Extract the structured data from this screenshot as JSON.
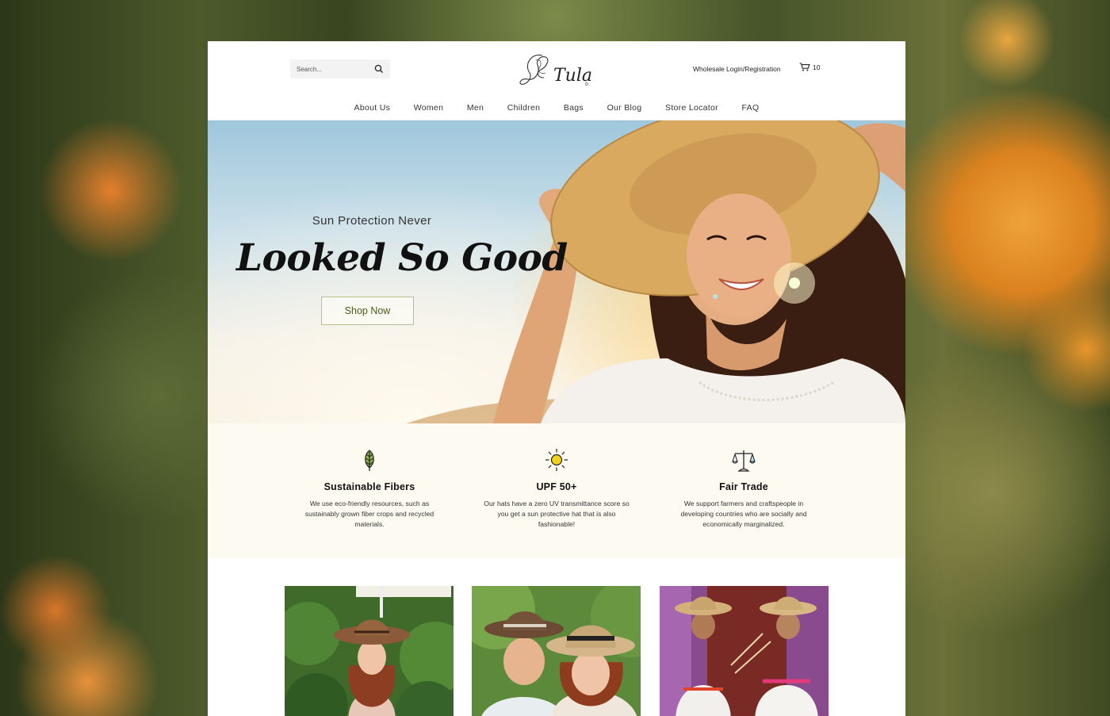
{
  "header": {
    "search_placeholder": "Search...",
    "logo_text": "Tula",
    "wholesale_link": "Wholesale Login/Registration",
    "cart_count": "10"
  },
  "nav": {
    "items": [
      "About Us",
      "Women",
      "Men",
      "Children",
      "Bags",
      "Our Blog",
      "Store Locator",
      "FAQ"
    ]
  },
  "hero": {
    "subtitle": "Sun Protection Never",
    "title": "Looked So Good",
    "cta": "Shop Now"
  },
  "features": [
    {
      "icon": "leaf-icon",
      "title": "Sustainable Fibers",
      "text": "We use eco-friendly resources, such as sustainably grown fiber crops and recycled materials."
    },
    {
      "icon": "sun-icon",
      "title": "UPF 50+",
      "text": "Our hats have a zero UV transmittance score so you get a sun protective hat that is also fashionable!"
    },
    {
      "icon": "scale-icon",
      "title": "Fair Trade",
      "text": "We support farmers and craftspeople in developing countries who are socially and economically marginalized."
    }
  ],
  "colors": {
    "accent_green": "#4a5a1e",
    "feature_band": "#fdfbf1",
    "sun_yellow": "#f3d21c"
  }
}
